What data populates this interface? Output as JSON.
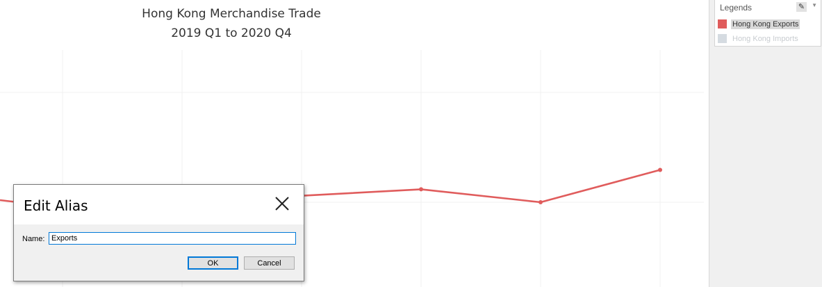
{
  "chart": {
    "title_line1": "Hong Kong Merchandise Trade",
    "title_line2": "2019 Q1 to 2020 Q4"
  },
  "chart_data": {
    "type": "line",
    "title": "Hong Kong Merchandise Trade 2019 Q1 to 2020 Q4",
    "xlabel": "",
    "ylabel": "",
    "grid": true,
    "series": [
      {
        "name": "Hong Kong Exports",
        "color": "#e05c5c",
        "visible": true,
        "points": [
          [
            3,
            0.7
          ],
          [
            4,
            0.78
          ],
          [
            5,
            0.8
          ],
          [
            6,
            0.76
          ],
          [
            7,
            0.86
          ]
        ]
      },
      {
        "name": "Hong Kong Imports",
        "color": "#d5dbe1",
        "visible": false,
        "points": []
      }
    ]
  },
  "legend": {
    "title": "Legends",
    "items": [
      {
        "label": "Hong Kong Exports",
        "color": "#e05c5c"
      },
      {
        "label": "Hong Kong Imports",
        "color": "#d5dbe1"
      }
    ]
  },
  "dialog": {
    "title": "Edit Alias",
    "name_label": "Name:",
    "name_value": "Exports",
    "ok_label": "OK",
    "cancel_label": "Cancel"
  },
  "icons": {
    "legend_edit": "pen-icon",
    "legend_menu": "chevron-down-icon",
    "dialog_close": "close-icon"
  }
}
